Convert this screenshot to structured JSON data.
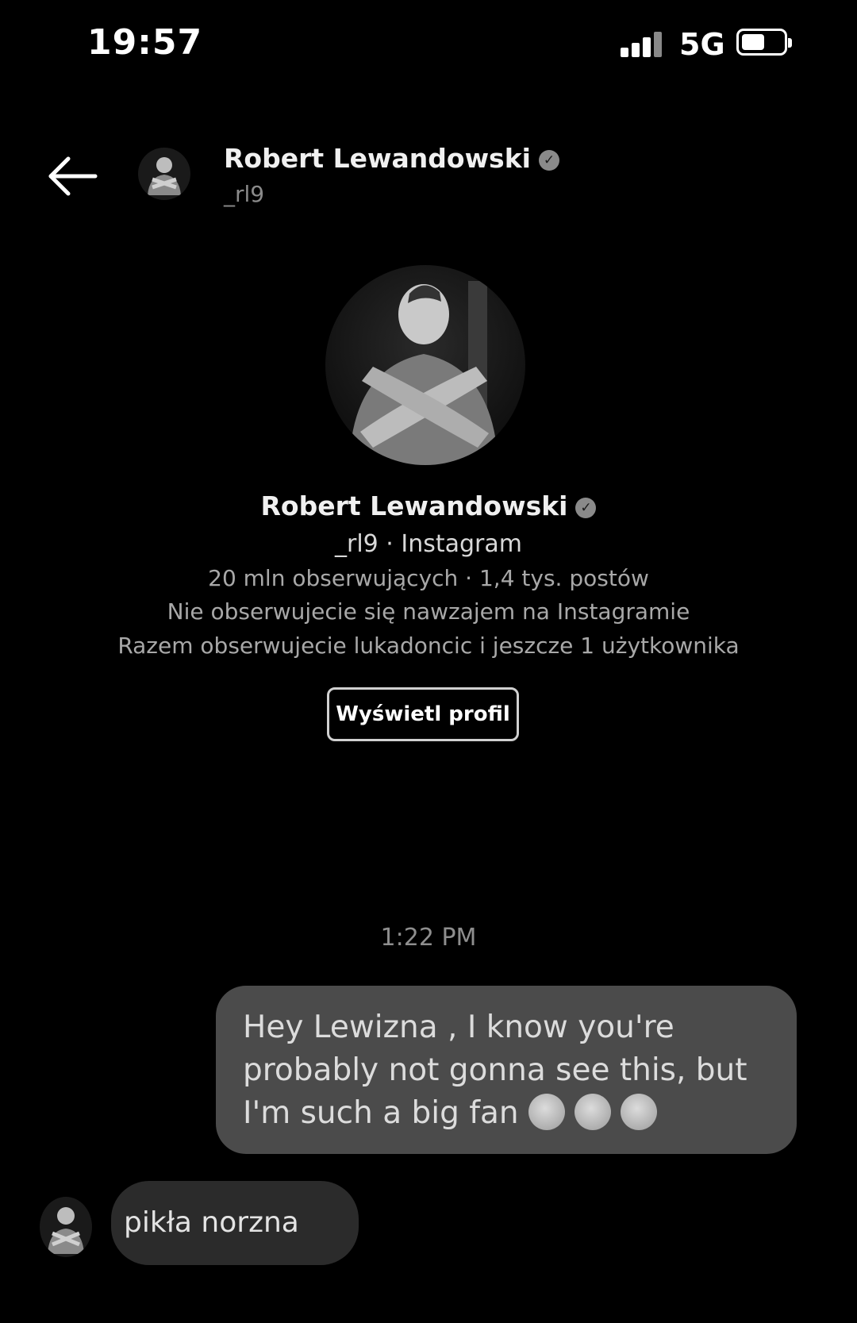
{
  "status_bar": {
    "time": "19:57",
    "network": "5G",
    "battery_level": 0.5
  },
  "header": {
    "name": "Robert Lewandowski",
    "handle": "_rl9"
  },
  "profile": {
    "name": "Robert Lewandowski",
    "handle_source": "_rl9 · Instagram",
    "stats": "20 mln obserwujących · 1,4 tys. postów",
    "follow_note": "Nie obserwujecie się nawzajem na Instagramie",
    "mutuals_note": "Razem obserwujecie lukadoncic i jeszcze 1 użytkownika",
    "view_profile_label": "Wyświetl profil"
  },
  "conversation": {
    "timestamp": "1:22 PM",
    "messages": [
      {
        "direction": "outgoing",
        "text": "Hey Lewizna , I know you're probably not gonna see this, but I'm such a big fan",
        "emoji": [
          "grinning-face",
          "grinning-face",
          "grinning-face"
        ]
      },
      {
        "direction": "incoming",
        "text": "pikła norzna"
      }
    ]
  },
  "icons": {
    "back": "back-arrow-icon",
    "verified": "verified-badge-icon"
  }
}
